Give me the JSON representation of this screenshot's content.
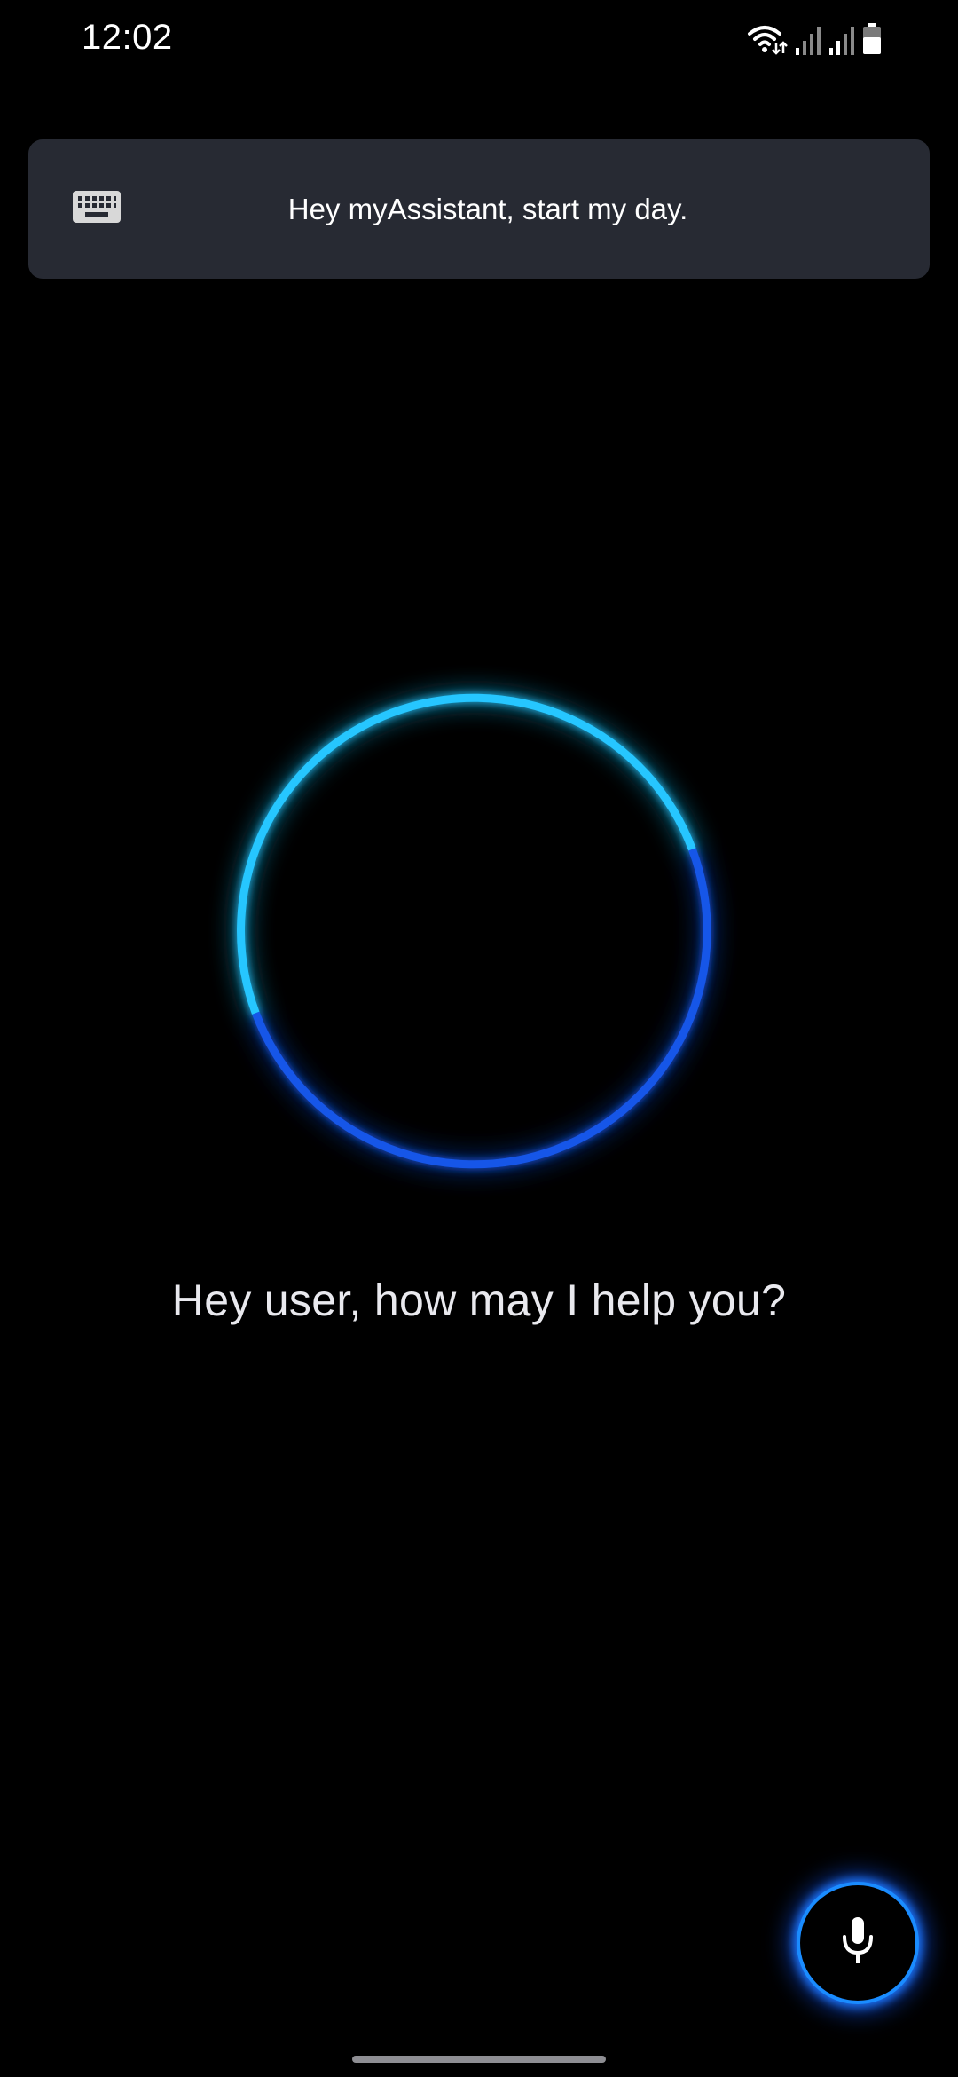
{
  "status_bar": {
    "time": "12:02",
    "icons": [
      "wifi-icon",
      "signal-icon",
      "signal-icon",
      "battery-icon"
    ]
  },
  "prompt_card": {
    "keyboard_icon": "keyboard-icon",
    "text": "Hey myAssistant, start my day."
  },
  "assistant": {
    "greeting": "Hey user, how may I help you?"
  },
  "mic_button": {
    "icon": "microphone-icon"
  },
  "colors": {
    "background": "#000000",
    "card": "#272a33",
    "orb_light": "#26c6ff",
    "orb_dark": "#1656e8",
    "accent": "#1a8cff"
  }
}
